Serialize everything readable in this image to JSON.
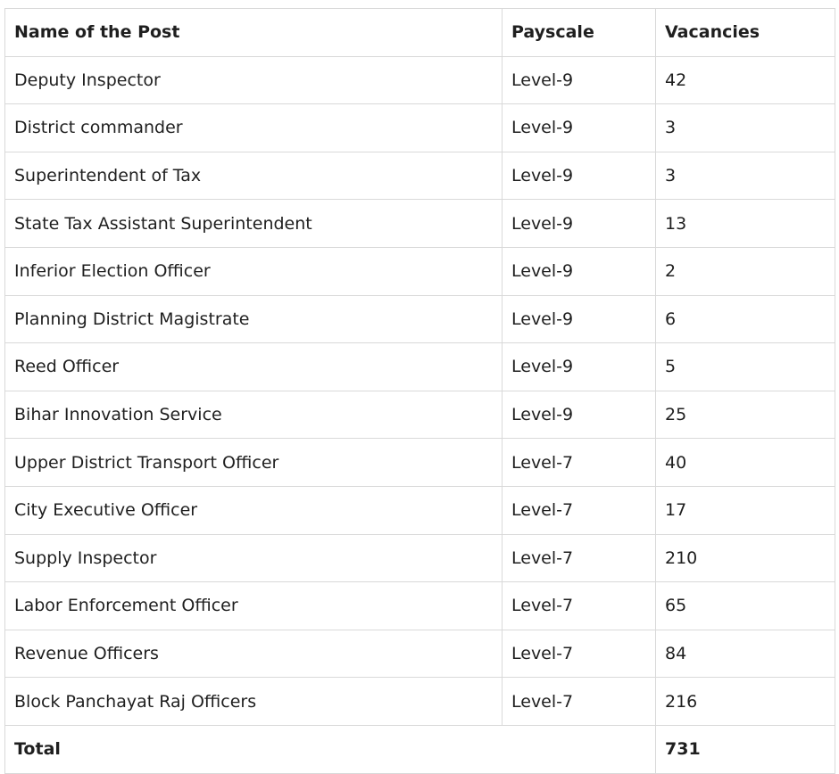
{
  "table": {
    "headers": [
      "Name of the Post",
      "Payscale",
      "Vacancies"
    ],
    "rows": [
      {
        "post": "Deputy Inspector",
        "payscale": "Level-9",
        "vacancies": "42"
      },
      {
        "post": "District commander",
        "payscale": "Level-9",
        "vacancies": "3"
      },
      {
        "post": "Superintendent of Tax",
        "payscale": "Level-9",
        "vacancies": "3"
      },
      {
        "post": "State Tax Assistant Superintendent",
        "payscale": "Level-9",
        "vacancies": "13"
      },
      {
        "post": "Inferior Election Officer",
        "payscale": "Level-9",
        "vacancies": "2"
      },
      {
        "post": "Planning District Magistrate",
        "payscale": "Level-9",
        "vacancies": "6"
      },
      {
        "post": "Reed Officer",
        "payscale": "Level-9",
        "vacancies": "5"
      },
      {
        "post": "Bihar Innovation Service",
        "payscale": "Level-9",
        "vacancies": "25"
      },
      {
        "post": "Upper District Transport Officer",
        "payscale": "Level-7",
        "vacancies": "40"
      },
      {
        "post": "City Executive Officer",
        "payscale": "Level-7",
        "vacancies": "17"
      },
      {
        "post": "Supply Inspector",
        "payscale": "Level-7",
        "vacancies": "210"
      },
      {
        "post": "Labor Enforcement Officer",
        "payscale": "Level-7",
        "vacancies": "65"
      },
      {
        "post": "Revenue Officers",
        "payscale": "Level-7",
        "vacancies": "84"
      },
      {
        "post": "Block Panchayat Raj Officers",
        "payscale": "Level-7",
        "vacancies": "216"
      }
    ],
    "total": {
      "label": "Total",
      "value": "731"
    }
  }
}
